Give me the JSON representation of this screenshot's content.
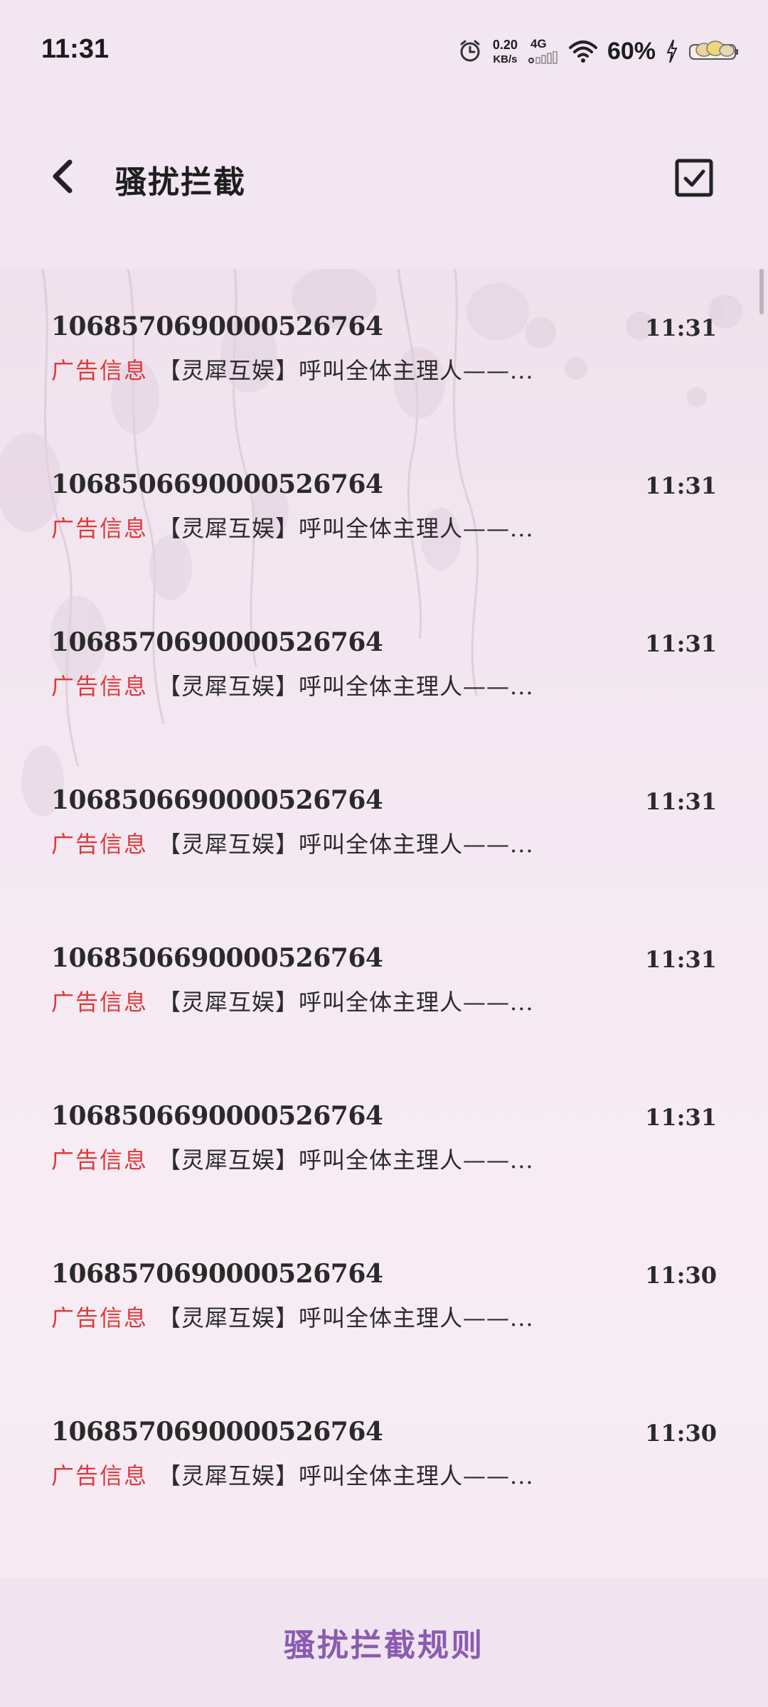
{
  "status_bar": {
    "time": "11:31",
    "net_speed_value": "0.20",
    "net_speed_unit": "KB/s",
    "network_type": "4G",
    "battery": "60%"
  },
  "header": {
    "title": "骚扰拦截",
    "back_icon": "chevron-left-icon",
    "select_icon": "checkbox-checked-icon"
  },
  "messages": [
    {
      "sender": "1068570690000526764",
      "time": "11:31",
      "tag": "广告信息",
      "preview": "【灵犀互娱】呼叫全体主理人——..."
    },
    {
      "sender": "1068506690000526764",
      "time": "11:31",
      "tag": "广告信息",
      "preview": "【灵犀互娱】呼叫全体主理人——..."
    },
    {
      "sender": "1068570690000526764",
      "time": "11:31",
      "tag": "广告信息",
      "preview": "【灵犀互娱】呼叫全体主理人——..."
    },
    {
      "sender": "1068506690000526764",
      "time": "11:31",
      "tag": "广告信息",
      "preview": "【灵犀互娱】呼叫全体主理人——..."
    },
    {
      "sender": "1068506690000526764",
      "time": "11:31",
      "tag": "广告信息",
      "preview": "【灵犀互娱】呼叫全体主理人——..."
    },
    {
      "sender": "1068506690000526764",
      "time": "11:31",
      "tag": "广告信息",
      "preview": "【灵犀互娱】呼叫全体主理人——..."
    },
    {
      "sender": "1068570690000526764",
      "time": "11:30",
      "tag": "广告信息",
      "preview": "【灵犀互娱】呼叫全体主理人——..."
    },
    {
      "sender": "1068570690000526764",
      "time": "11:30",
      "tag": "广告信息",
      "preview": "【灵犀互娱】呼叫全体主理人——..."
    }
  ],
  "footer": {
    "rules_label": "骚扰拦截规则"
  },
  "colors": {
    "tag": "#e23838",
    "rules": "#8a5bb0",
    "background": "#f1e6f1"
  }
}
